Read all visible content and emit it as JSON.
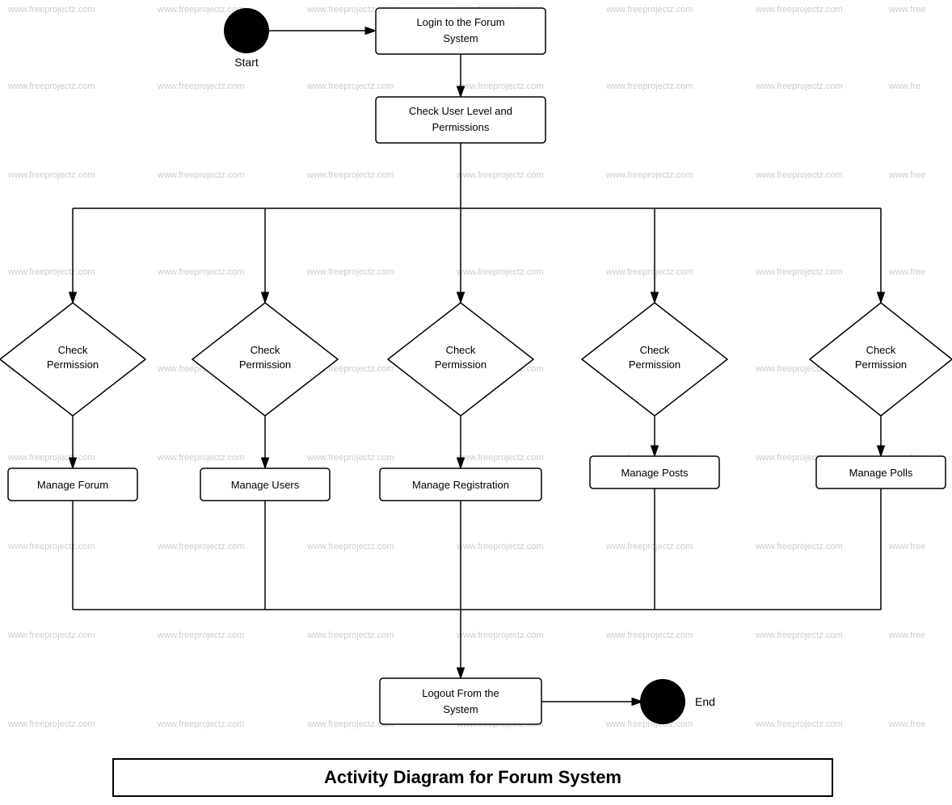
{
  "title": "Activity Diagram for Forum System",
  "watermark": "www.freeprojectz.com",
  "nodes": {
    "start_label": "Start",
    "end_label": "End",
    "login": "Login to the Forum System",
    "check_user_level": "Check User Level and Permissions",
    "check_perm1": "Check Permission",
    "check_perm2": "Check Permission",
    "check_perm3": "Check Permission",
    "check_perm4": "Check Permission",
    "check_perm5": "Check Permission",
    "manage_forum": "Manage Forum",
    "manage_users": "Manage Users",
    "manage_registration": "Manage Registration",
    "manage_posts": "Manage Posts",
    "manage_polls": "Manage Polls",
    "logout": "Logout From the System"
  }
}
